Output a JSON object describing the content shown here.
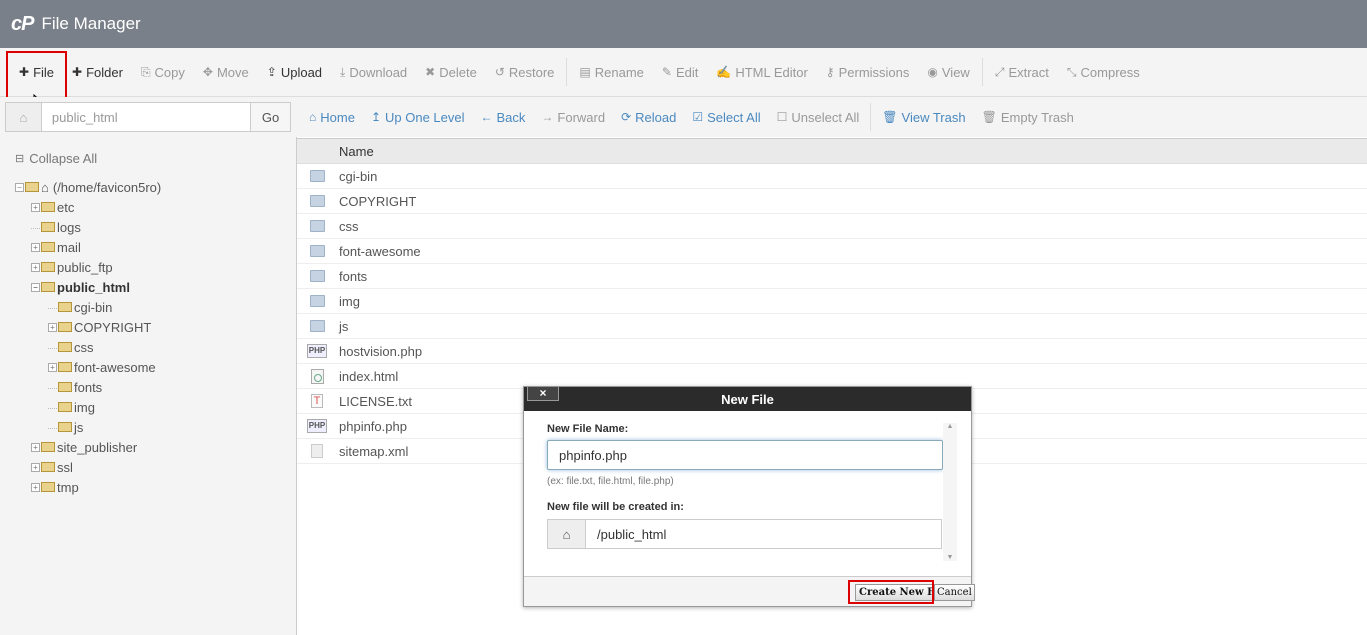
{
  "header": {
    "logo": "cP",
    "title": "File Manager"
  },
  "toolbar": [
    {
      "key": "file",
      "icon": "plus-icon",
      "glyph": "✚",
      "label": "File",
      "active": true
    },
    {
      "key": "folder",
      "icon": "plus-icon",
      "glyph": "✚",
      "label": "Folder",
      "active": true
    },
    {
      "key": "copy",
      "icon": "copy-icon",
      "glyph": "⎘",
      "label": "Copy",
      "active": false
    },
    {
      "key": "move",
      "icon": "move-icon",
      "glyph": "✥",
      "label": "Move",
      "active": false
    },
    {
      "key": "upload",
      "icon": "upload-icon",
      "glyph": "⇪",
      "label": "Upload",
      "active": true
    },
    {
      "key": "download",
      "icon": "download-icon",
      "glyph": "⤓",
      "label": "Download",
      "active": false
    },
    {
      "key": "delete",
      "icon": "delete-icon",
      "glyph": "✖",
      "label": "Delete",
      "active": false
    },
    {
      "key": "restore",
      "icon": "restore-icon",
      "glyph": "↺",
      "label": "Restore",
      "active": false
    },
    {
      "key": "rename",
      "icon": "rename-icon",
      "glyph": "▤",
      "label": "Rename",
      "active": false
    },
    {
      "key": "edit",
      "icon": "pencil-icon",
      "glyph": "✎",
      "label": "Edit",
      "active": false
    },
    {
      "key": "html-editor",
      "icon": "html-editor-icon",
      "glyph": "✍",
      "label": "HTML Editor",
      "active": false
    },
    {
      "key": "permissions",
      "icon": "key-icon",
      "glyph": "⚷",
      "label": "Permissions",
      "active": false
    },
    {
      "key": "view",
      "icon": "eye-icon",
      "glyph": "◉",
      "label": "View",
      "active": false
    },
    {
      "key": "extract",
      "icon": "extract-icon",
      "glyph": "⤢",
      "label": "Extract",
      "active": false
    },
    {
      "key": "compress",
      "icon": "compress-icon",
      "glyph": "⤡",
      "label": "Compress",
      "active": false
    }
  ],
  "pathbar": {
    "value": "public_html",
    "go_label": "Go"
  },
  "navbar": [
    {
      "key": "home",
      "icon": "home-icon",
      "glyph": "⌂",
      "label": "Home",
      "enabled": true
    },
    {
      "key": "up-one-level",
      "icon": "arrow-up-icon",
      "glyph": "↥",
      "label": "Up One Level",
      "enabled": true
    },
    {
      "key": "back",
      "icon": "arrow-left-icon",
      "glyph": "←",
      "label": "Back",
      "enabled": true
    },
    {
      "key": "forward",
      "icon": "arrow-right-icon",
      "glyph": "→",
      "label": "Forward",
      "enabled": false
    },
    {
      "key": "reload",
      "icon": "reload-icon",
      "glyph": "⟳",
      "label": "Reload",
      "enabled": true
    },
    {
      "key": "select-all",
      "icon": "checkbox-checked-icon",
      "glyph": "☑",
      "label": "Select All",
      "enabled": true
    },
    {
      "key": "unselect-all",
      "icon": "checkbox-empty-icon",
      "glyph": "☐",
      "label": "Unselect All",
      "enabled": false
    },
    {
      "key": "view-trash",
      "icon": "trash-icon",
      "glyph": "🗑",
      "label": "View Trash",
      "enabled": true
    },
    {
      "key": "empty-trash",
      "icon": "trash-icon",
      "glyph": "🗑",
      "label": "Empty Trash",
      "enabled": false
    }
  ],
  "tree": {
    "collapse_label": "Collapse All",
    "root_label": "(/home/favicon5ro)",
    "nodes": [
      {
        "label": "etc",
        "expander": "+",
        "level": 1,
        "bold": false
      },
      {
        "label": "logs",
        "expander": "",
        "level": 1,
        "bold": false
      },
      {
        "label": "mail",
        "expander": "+",
        "level": 1,
        "bold": false
      },
      {
        "label": "public_ftp",
        "expander": "+",
        "level": 1,
        "bold": false
      },
      {
        "label": "public_html",
        "expander": "−",
        "level": 1,
        "bold": true
      },
      {
        "label": "cgi-bin",
        "expander": "",
        "level": 2,
        "bold": false
      },
      {
        "label": "COPYRIGHT",
        "expander": "+",
        "level": 2,
        "bold": false
      },
      {
        "label": "css",
        "expander": "",
        "level": 2,
        "bold": false
      },
      {
        "label": "font-awesome",
        "expander": "+",
        "level": 2,
        "bold": false
      },
      {
        "label": "fonts",
        "expander": "",
        "level": 2,
        "bold": false
      },
      {
        "label": "img",
        "expander": "",
        "level": 2,
        "bold": false
      },
      {
        "label": "js",
        "expander": "",
        "level": 2,
        "bold": false
      },
      {
        "label": "site_publisher",
        "expander": "+",
        "level": 1,
        "bold": false
      },
      {
        "label": "ssl",
        "expander": "+",
        "level": 1,
        "bold": false
      },
      {
        "label": "tmp",
        "expander": "+",
        "level": 1,
        "bold": false
      }
    ]
  },
  "filelist": {
    "header_name": "Name",
    "rows": [
      {
        "name": "cgi-bin",
        "type": "folder"
      },
      {
        "name": "COPYRIGHT",
        "type": "folder"
      },
      {
        "name": "css",
        "type": "folder"
      },
      {
        "name": "font-awesome",
        "type": "folder"
      },
      {
        "name": "fonts",
        "type": "folder"
      },
      {
        "name": "img",
        "type": "folder"
      },
      {
        "name": "js",
        "type": "folder"
      },
      {
        "name": "hostvision.php",
        "type": "php"
      },
      {
        "name": "index.html",
        "type": "html"
      },
      {
        "name": "LICENSE.txt",
        "type": "txt"
      },
      {
        "name": "phpinfo.php",
        "type": "php"
      },
      {
        "name": "sitemap.xml",
        "type": "xml"
      }
    ]
  },
  "dialog": {
    "title": "New File",
    "close_glyph": "×",
    "name_label": "New File Name:",
    "name_value": "phpinfo.php",
    "hint": "(ex: file.txt, file.html, file.php)",
    "location_label": "New file will be created in:",
    "location_value": "/public_html",
    "create_label": "Create New File",
    "cancel_label": "Cancel"
  },
  "colors": {
    "header_bg": "#7a8089",
    "link": "#4a89c0",
    "highlight": "#dd0000",
    "dialog_title_bg": "#2b2b2b"
  }
}
